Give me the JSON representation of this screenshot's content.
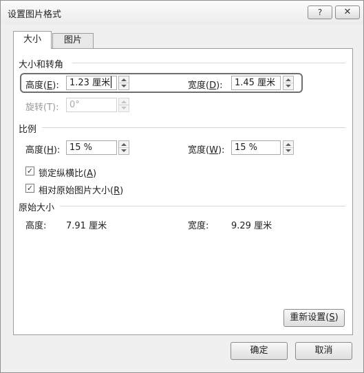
{
  "window": {
    "title": "设置图片格式",
    "help_label": "?",
    "close_label": "✕"
  },
  "tabs": [
    {
      "label": "大小"
    },
    {
      "label": "图片"
    }
  ],
  "size_rotation": {
    "section_label": "大小和转角",
    "height": {
      "label": "高度(",
      "key": "E",
      "suffix": "):",
      "value": "1.23 厘米"
    },
    "width": {
      "label": "宽度(",
      "key": "D",
      "suffix": "):",
      "value": "1.45 厘米"
    },
    "rotation": {
      "label": "旋转(T):",
      "value": "0°"
    }
  },
  "scale": {
    "section_label": "比例",
    "height": {
      "label": "高度(",
      "key": "H",
      "suffix": "):",
      "value": "15 %"
    },
    "width": {
      "label": "宽度(",
      "key": "W",
      "suffix": "):",
      "value": "15 %"
    },
    "lock_aspect": {
      "label": "锁定纵横比(",
      "key": "A",
      "suffix": ")",
      "checked": "✓"
    },
    "relative_original": {
      "label": "相对原始图片大小(",
      "key": "R",
      "suffix": ")",
      "checked": "✓"
    }
  },
  "original_size": {
    "section_label": "原始大小",
    "height_label": "高度:",
    "height_value": "7.91 厘米",
    "width_label": "宽度:",
    "width_value": "9.29 厘米"
  },
  "reset_button": {
    "label": "重新设置(",
    "key": "S",
    "suffix": ")"
  },
  "footer": {
    "ok_label": "确定",
    "cancel_label": "取消"
  }
}
